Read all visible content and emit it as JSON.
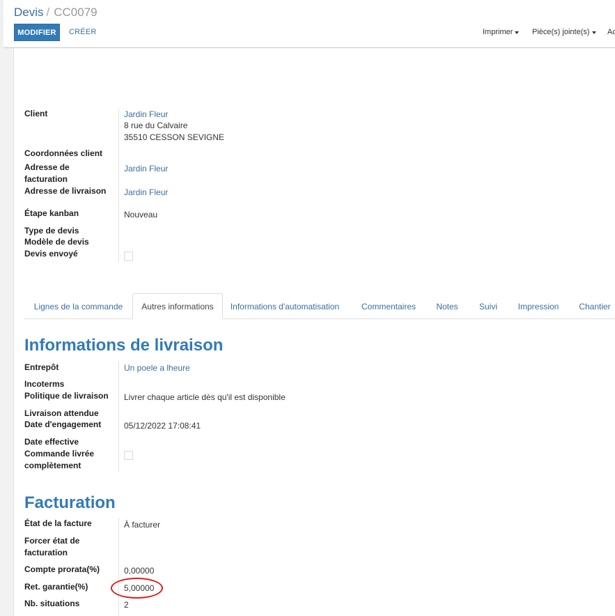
{
  "breadcrumb": {
    "parent": "Devis",
    "separator": "/",
    "current": "CC0079"
  },
  "buttons": {
    "edit": "MODIFIER",
    "create": "CRÉER"
  },
  "actions": {
    "print": "Imprimer",
    "attachments": "Pièce(s) jointe(s)",
    "action": "Ac"
  },
  "header_fields": {
    "client_label": "Client",
    "client_name": "Jardin Fleur",
    "client_address1": "8 rue du Calvaire",
    "client_address2": "35510 CESSON SEVIGNE",
    "contact_label": "Coordonnées client",
    "invoice_addr_label1": "Adresse de",
    "invoice_addr_label2": "facturation",
    "invoice_addr_value": "Jardin Fleur",
    "delivery_addr_label": "Adresse de livraison",
    "delivery_addr_value": "Jardin Fleur",
    "kanban_label": "Étape kanban",
    "kanban_value": "Nouveau",
    "quote_type_label": "Type de devis",
    "quote_template_label": "Modèle de devis",
    "quote_sent_label": "Devis envoyé",
    "quote_sent_checked": false
  },
  "tabs": [
    {
      "label": "Lignes de la commande",
      "active": false
    },
    {
      "label": "Autres informations",
      "active": true
    },
    {
      "label": "Informations d'automatisation",
      "active": false
    },
    {
      "label": "Commentaires",
      "active": false
    },
    {
      "label": "Notes",
      "active": false
    },
    {
      "label": "Suivi",
      "active": false
    },
    {
      "label": "Impression",
      "active": false
    },
    {
      "label": "Chantier",
      "active": false
    }
  ],
  "delivery": {
    "title": "Informations de livraison",
    "warehouse_label": "Entrepôt",
    "warehouse_value": "Un poele a lheure",
    "incoterms_label": "Incoterms",
    "policy_label": "Politique de livraison",
    "policy_value": "Livrer chaque article dès qu'il est disponible",
    "expected_label": "Livraison attendue",
    "commitment_label": "Date d'engagement",
    "commitment_value": "05/12/2022 17:08:41",
    "effective_label": "Date effective",
    "fully_delivered_label1": "Commande livrée",
    "fully_delivered_label2": "complètement",
    "fully_delivered_checked": false
  },
  "invoicing": {
    "title": "Facturation",
    "state_label": "État de la facture",
    "state_value": "À facturer",
    "force_label1": "Forcer état de",
    "force_label2": "facturation",
    "prorata_label": "Compte prorata(%)",
    "prorata_value": "0,00000",
    "retention_label": "Ret. garantie(%)",
    "retention_value": "5,00000",
    "situations_label": "Nb. situations",
    "situations_value": "2"
  },
  "colors": {
    "primary": "#337ab7",
    "link": "#3a6f9f",
    "highlight": "#e01b1b"
  }
}
